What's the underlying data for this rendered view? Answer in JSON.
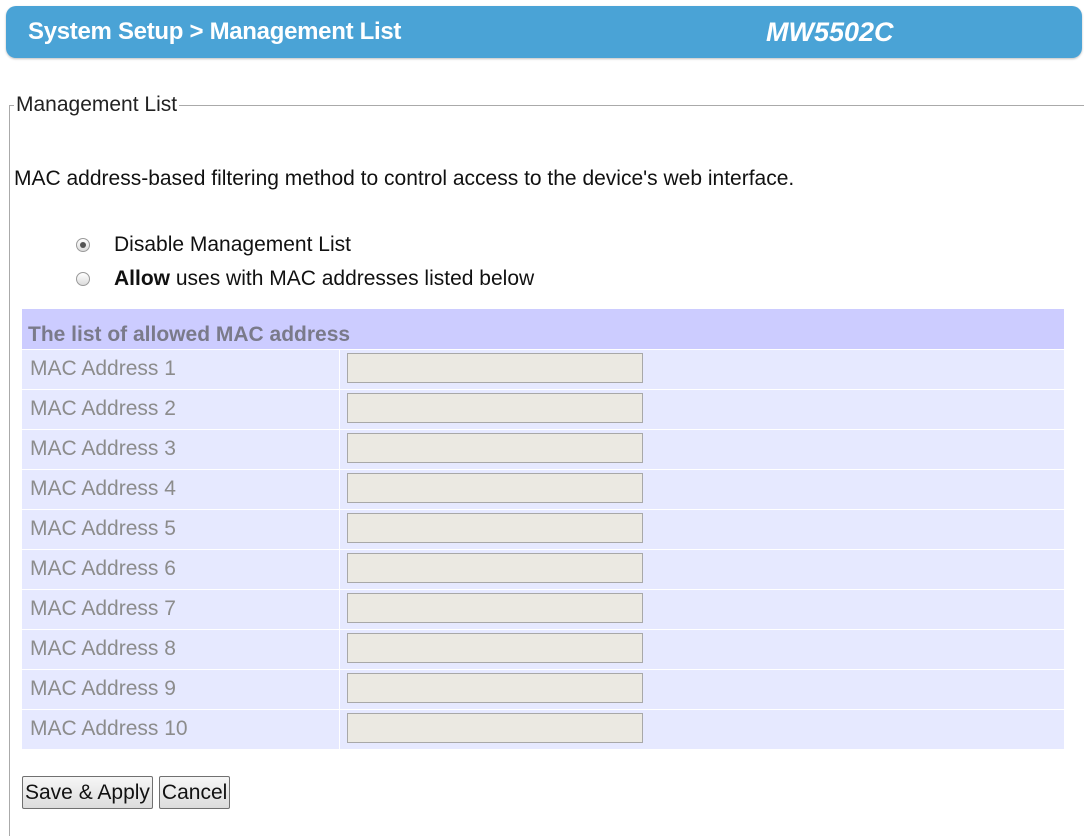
{
  "header": {
    "title": "System Setup > Management List",
    "model": "MW5502C",
    "bar_color": "#4aa3d6"
  },
  "section": {
    "legend": "Management List",
    "description": "MAC address-based filtering method to control access to the device's web interface."
  },
  "options": {
    "disable_label": "Disable Management List",
    "disable_checked": true,
    "allow_bold": "Allow",
    "allow_rest": " uses with MAC addresses listed below",
    "allow_checked": false
  },
  "mac_table": {
    "header": "The list of allowed MAC address",
    "header_color": "#ccccff",
    "row_color": "#e6e9ff",
    "rows": [
      {
        "label": "MAC Address 1",
        "value": ""
      },
      {
        "label": "MAC Address 2",
        "value": ""
      },
      {
        "label": "MAC Address 3",
        "value": ""
      },
      {
        "label": "MAC Address 4",
        "value": ""
      },
      {
        "label": "MAC Address 5",
        "value": ""
      },
      {
        "label": "MAC Address 6",
        "value": ""
      },
      {
        "label": "MAC Address 7",
        "value": ""
      },
      {
        "label": "MAC Address 8",
        "value": ""
      },
      {
        "label": "MAC Address 9",
        "value": ""
      },
      {
        "label": "MAC Address 10",
        "value": ""
      }
    ]
  },
  "buttons": {
    "save_label": "Save & Apply",
    "cancel_label": "Cancel"
  }
}
